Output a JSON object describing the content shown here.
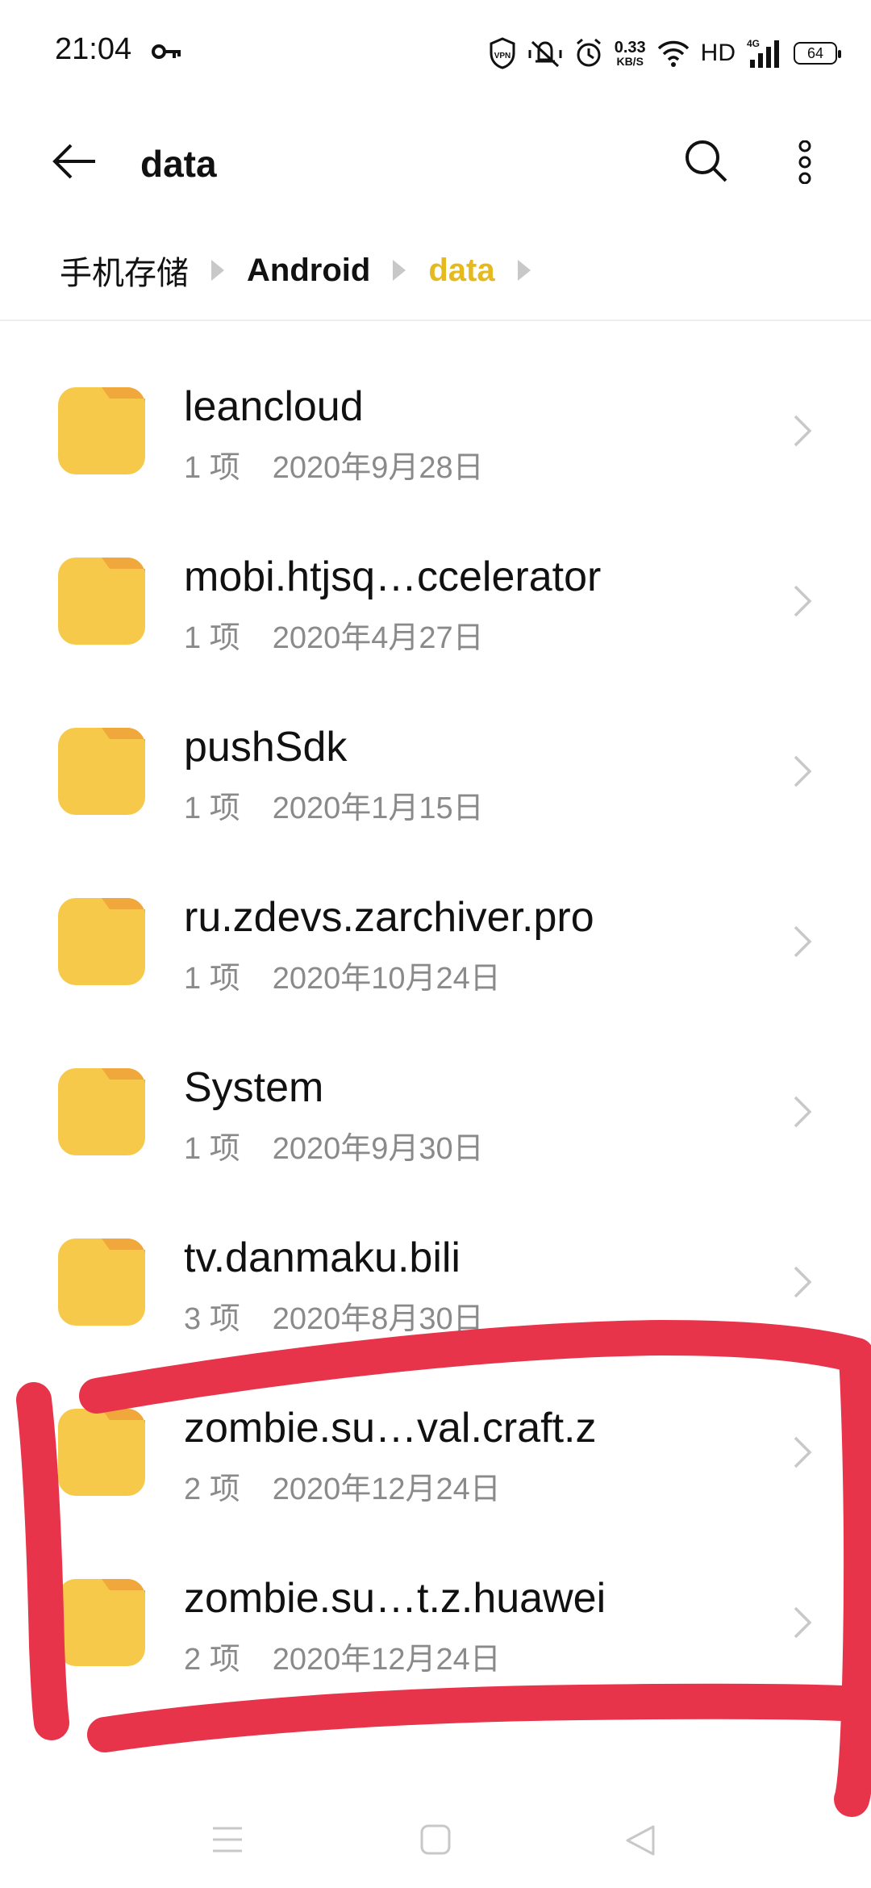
{
  "status_bar": {
    "time": "21:04",
    "speed_value": "0.33",
    "speed_unit": "KB/S",
    "hd": "HD",
    "battery": "64",
    "icons": [
      "key-icon",
      "vpn-icon",
      "vibrate-mute-icon",
      "alarm-icon",
      "wifi-icon",
      "signal-4g-icon",
      "battery-icon"
    ]
  },
  "toolbar": {
    "title": "data",
    "icons": [
      "back-arrow-icon",
      "search-icon",
      "more-vert-icon"
    ]
  },
  "breadcrumb": [
    {
      "label": "手机存储"
    },
    {
      "label": "Android"
    },
    {
      "label": "data"
    }
  ],
  "files": [
    {
      "name": "leancloud",
      "count": "1 项",
      "date": "2020年9月28日"
    },
    {
      "name": "mobi.htjsq…ccelerator",
      "count": "1 项",
      "date": "2020年4月27日"
    },
    {
      "name": "pushSdk",
      "count": "1 项",
      "date": "2020年1月15日"
    },
    {
      "name": "ru.zdevs.zarchiver.pro",
      "count": "1 项",
      "date": "2020年10月24日"
    },
    {
      "name": "System",
      "count": "1 项",
      "date": "2020年9月30日"
    },
    {
      "name": "tv.danmaku.bili",
      "count": "3 项",
      "date": "2020年8月30日"
    },
    {
      "name": "zombie.su…val.craft.z",
      "count": "2 项",
      "date": "2020年12月24日"
    },
    {
      "name": "zombie.su…t.z.huawei",
      "count": "2 项",
      "date": "2020年12月24日"
    }
  ],
  "colors": {
    "folder": "#f6c94b",
    "folder_tab": "#f0a83c",
    "breadcrumb_active": "#e5ba1e",
    "annotation": "#e8344a"
  },
  "nav_icons": [
    "menu-icon",
    "home-icon",
    "back-triangle-icon"
  ]
}
